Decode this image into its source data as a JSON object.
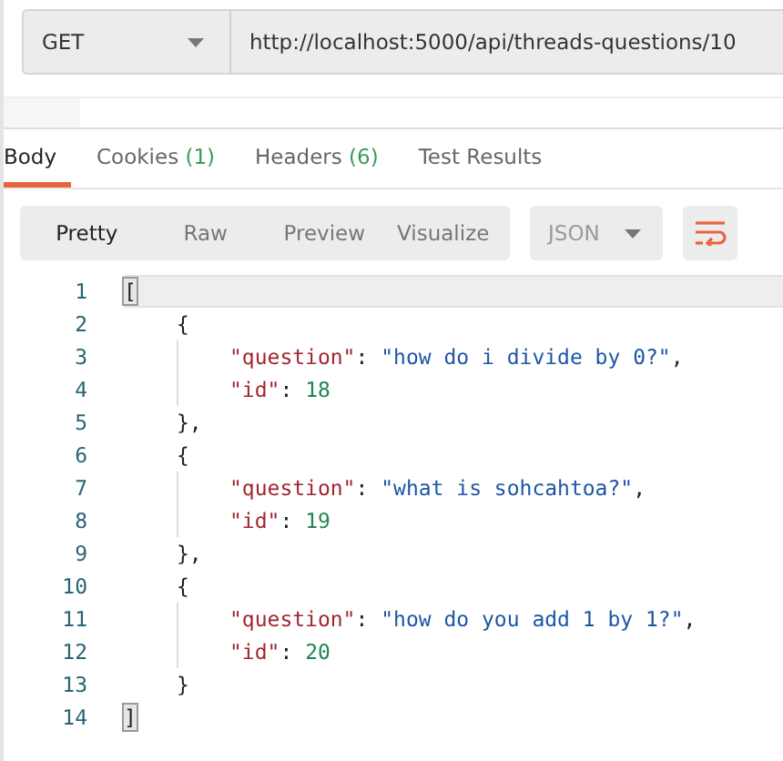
{
  "request": {
    "method": "GET",
    "url": "http://localhost:5000/api/threads-questions/10"
  },
  "response_tabs": [
    {
      "label": "Body",
      "selected": true
    },
    {
      "label": "Cookies",
      "count": "(1)",
      "selected": false
    },
    {
      "label": "Headers",
      "count": "(6)",
      "selected": false
    },
    {
      "label": "Test Results",
      "selected": false
    }
  ],
  "view_modes": [
    {
      "label": "Pretty",
      "selected": true
    },
    {
      "label": "Raw",
      "selected": false
    },
    {
      "label": "Preview",
      "selected": false
    },
    {
      "label": "Visualize",
      "selected": false
    }
  ],
  "format": {
    "value": "JSON",
    "disabled": true
  },
  "code_lines": [
    {
      "number": "1",
      "current": true,
      "tokens": [
        {
          "kind": "bracket",
          "text": "[",
          "matched": true
        }
      ]
    },
    {
      "number": "2",
      "current": false,
      "tokens": [
        {
          "kind": "punct",
          "text": "{"
        }
      ]
    },
    {
      "number": "3",
      "current": false,
      "tokens": [
        {
          "kind": "key",
          "text": "\"question\""
        },
        {
          "kind": "punct",
          "text": ": "
        },
        {
          "kind": "string",
          "text": "\"how do i divide by 0?\""
        },
        {
          "kind": "punct",
          "text": ","
        }
      ]
    },
    {
      "number": "4",
      "current": false,
      "tokens": [
        {
          "kind": "key",
          "text": "\"id\""
        },
        {
          "kind": "punct",
          "text": ": "
        },
        {
          "kind": "number",
          "text": "18"
        }
      ]
    },
    {
      "number": "5",
      "current": false,
      "tokens": [
        {
          "kind": "punct",
          "text": "},"
        }
      ]
    },
    {
      "number": "6",
      "current": false,
      "tokens": [
        {
          "kind": "punct",
          "text": "{"
        }
      ]
    },
    {
      "number": "7",
      "current": false,
      "tokens": [
        {
          "kind": "key",
          "text": "\"question\""
        },
        {
          "kind": "punct",
          "text": ": "
        },
        {
          "kind": "string",
          "text": "\"what is sohcahtoa?\""
        },
        {
          "kind": "punct",
          "text": ","
        }
      ]
    },
    {
      "number": "8",
      "current": false,
      "tokens": [
        {
          "kind": "key",
          "text": "\"id\""
        },
        {
          "kind": "punct",
          "text": ": "
        },
        {
          "kind": "number",
          "text": "19"
        }
      ]
    },
    {
      "number": "9",
      "current": false,
      "tokens": [
        {
          "kind": "punct",
          "text": "},"
        }
      ]
    },
    {
      "number": "10",
      "current": false,
      "tokens": [
        {
          "kind": "punct",
          "text": "{"
        }
      ]
    },
    {
      "number": "11",
      "current": false,
      "tokens": [
        {
          "kind": "key",
          "text": "\"question\""
        },
        {
          "kind": "punct",
          "text": ": "
        },
        {
          "kind": "string",
          "text": "\"how do you add 1 by 1?\""
        },
        {
          "kind": "punct",
          "text": ","
        }
      ]
    },
    {
      "number": "12",
      "current": false,
      "tokens": [
        {
          "kind": "key",
          "text": "\"id\""
        },
        {
          "kind": "punct",
          "text": ": "
        },
        {
          "kind": "number",
          "text": "20"
        }
      ]
    },
    {
      "number": "13",
      "current": false,
      "tokens": [
        {
          "kind": "punct",
          "text": "}"
        }
      ]
    },
    {
      "number": "14",
      "current": false,
      "tokens": [
        {
          "kind": "bracket",
          "text": "]",
          "matched": true
        }
      ]
    }
  ]
}
